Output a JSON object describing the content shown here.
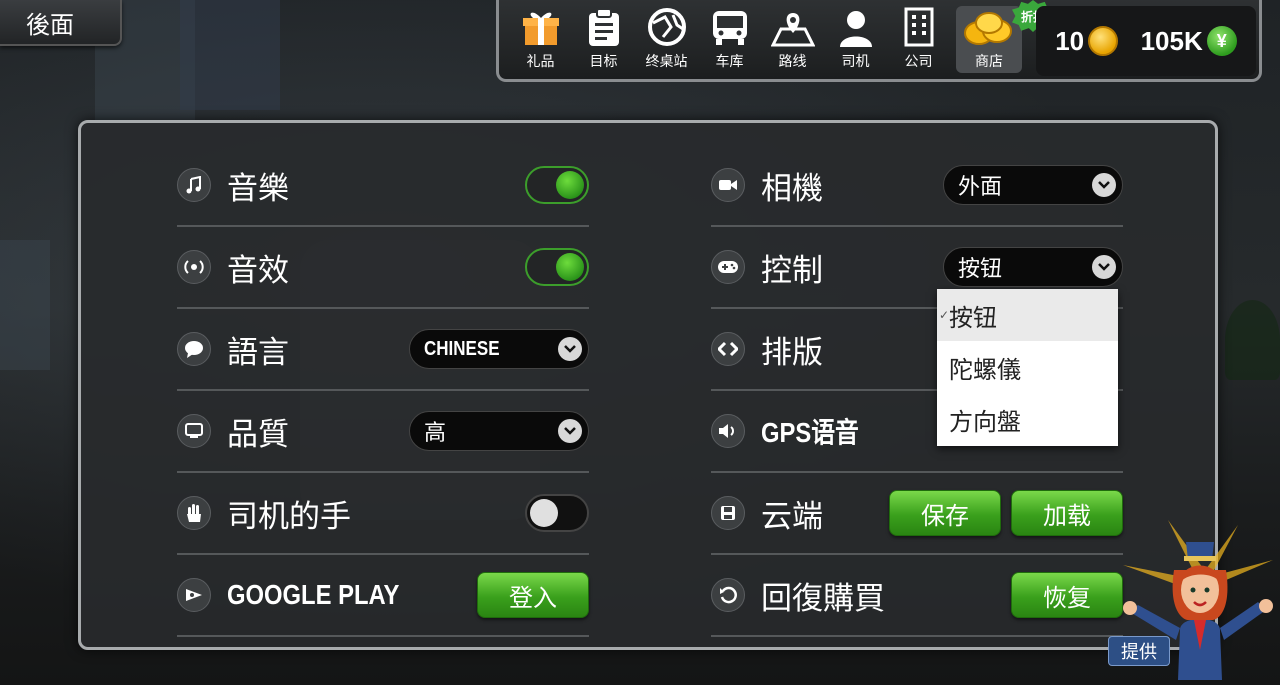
{
  "back_button": "後面",
  "nav": {
    "items": [
      {
        "label": "礼品",
        "icon": "gift-icon"
      },
      {
        "label": "目标",
        "icon": "clipboard-icon"
      },
      {
        "label": "终桌站",
        "icon": "globe-icon"
      },
      {
        "label": "车库",
        "icon": "bus-icon"
      },
      {
        "label": "路线",
        "icon": "map-pin-icon"
      },
      {
        "label": "司机",
        "icon": "person-icon"
      },
      {
        "label": "公司",
        "icon": "building-icon"
      }
    ],
    "shop": {
      "label": "商店",
      "icon": "coins-icon",
      "badge": "折扣"
    }
  },
  "currency": {
    "coins": "10",
    "cash": "105K"
  },
  "settings": {
    "music": {
      "label": "音樂",
      "state": "on"
    },
    "sfx": {
      "label": "音效",
      "state": "on"
    },
    "language": {
      "label": "語言",
      "value": "CHINESE"
    },
    "quality": {
      "label": "品質",
      "value": "高"
    },
    "driver_hands": {
      "label": "司机的手",
      "state": "off"
    },
    "google_play": {
      "label": "GOOGLE PLAY",
      "button": "登入"
    },
    "camera": {
      "label": "相機",
      "value": "外面"
    },
    "control": {
      "label": "控制",
      "value": "按钮"
    },
    "layout": {
      "label": "排版"
    },
    "gps_voice": {
      "label": "GPS语音"
    },
    "cloud": {
      "label": "云端",
      "save": "保存",
      "load": "加载"
    },
    "restore": {
      "label": "回復購買",
      "button": "恢复"
    }
  },
  "control_menu": {
    "options": [
      "按钮",
      "陀螺儀",
      "方向盤"
    ],
    "selected": "按钮"
  },
  "mascot": {
    "button": "提供"
  },
  "colors": {
    "accent_green": "#3aa01c",
    "panel": "#282a2c",
    "border": "#a8abad"
  }
}
